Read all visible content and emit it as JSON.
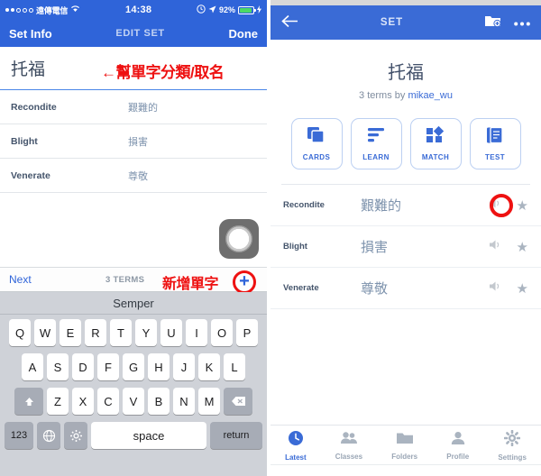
{
  "left": {
    "statusbar": {
      "carrier": "遠傳電信",
      "wifi_icon": "wifi-icon",
      "time": "14:38",
      "alarm_icon": "alarm-icon",
      "location_icon": "location-arrow-icon",
      "battery_percent": "92%",
      "charging_icon": "lightning-bolt-icon",
      "battery_level": 92
    },
    "navbar": {
      "left_label": "Set Info",
      "title": "EDIT SET",
      "right_label": "Done"
    },
    "set_title": "托福",
    "annotation_title": "←幫單字分類/取名",
    "terms": [
      {
        "term": "Recondite",
        "definition": "艱難的"
      },
      {
        "term": "Blight",
        "definition": "損害"
      },
      {
        "term": "Venerate",
        "definition": "尊敬"
      }
    ],
    "assistive_touch_icon": "assistive-touch-icon",
    "toolbar": {
      "next_label": "Next",
      "terms_count": "3 TERMS",
      "annotation_add": "新增單字",
      "add_icon": "plus-circle-icon",
      "add_icon_color": "#2f64d9",
      "annotation_color": "#ee1111"
    },
    "keyboard": {
      "suggestion": "Semper",
      "row1": [
        "Q",
        "W",
        "E",
        "R",
        "T",
        "Y",
        "U",
        "I",
        "O",
        "P"
      ],
      "row2": [
        "A",
        "S",
        "D",
        "F",
        "G",
        "H",
        "J",
        "K",
        "L"
      ],
      "row3": [
        "Z",
        "X",
        "C",
        "V",
        "B",
        "N",
        "M"
      ],
      "shift_icon": "shift-up-arrow-icon",
      "backspace_icon": "backspace-icon",
      "numeric_label": "123",
      "globe_icon": "globe-icon",
      "gear_icon": "gear-icon",
      "space_label": "space",
      "return_label": "return"
    }
  },
  "right": {
    "navbar": {
      "back_icon": "back-arrow-icon",
      "title": "SET",
      "add_folder_icon": "folder-plus-icon",
      "overflow_icon": "more-options-icon"
    },
    "set_title": "托福",
    "subtitle_prefix": "3 terms by ",
    "author": "mikae_wu",
    "modes": [
      {
        "label": "CARDS",
        "icon": "cards-icon"
      },
      {
        "label": "LEARN",
        "icon": "learn-bars-icon"
      },
      {
        "label": "MATCH",
        "icon": "match-shapes-icon"
      },
      {
        "label": "TEST",
        "icon": "test-document-icon"
      }
    ],
    "terms": [
      {
        "term": "Recondite",
        "definition": "艱難的",
        "speaker_icon": "speaker-icon",
        "star_icon": "star-icon",
        "highlighted": true
      },
      {
        "term": "Blight",
        "definition": "損害",
        "speaker_icon": "speaker-icon",
        "star_icon": "star-icon",
        "highlighted": false
      },
      {
        "term": "Venerate",
        "definition": "尊敬",
        "speaker_icon": "speaker-icon",
        "star_icon": "star-icon",
        "highlighted": false
      }
    ],
    "assistive_touch_icon": "assistive-touch-icon",
    "tabs": [
      {
        "label": "Latest",
        "icon": "clock-icon",
        "active": true
      },
      {
        "label": "Classes",
        "icon": "people-icon",
        "active": false
      },
      {
        "label": "Folders",
        "icon": "folder-icon",
        "active": false
      },
      {
        "label": "Profile",
        "icon": "person-icon",
        "active": false
      },
      {
        "label": "Settings",
        "icon": "gear-icon",
        "active": false
      }
    ]
  },
  "colors": {
    "brand_blue": "#2f64d9",
    "nav_blue": "#3a6bd6",
    "annotation_red": "#ee1111",
    "battery_green": "#4cd964"
  }
}
